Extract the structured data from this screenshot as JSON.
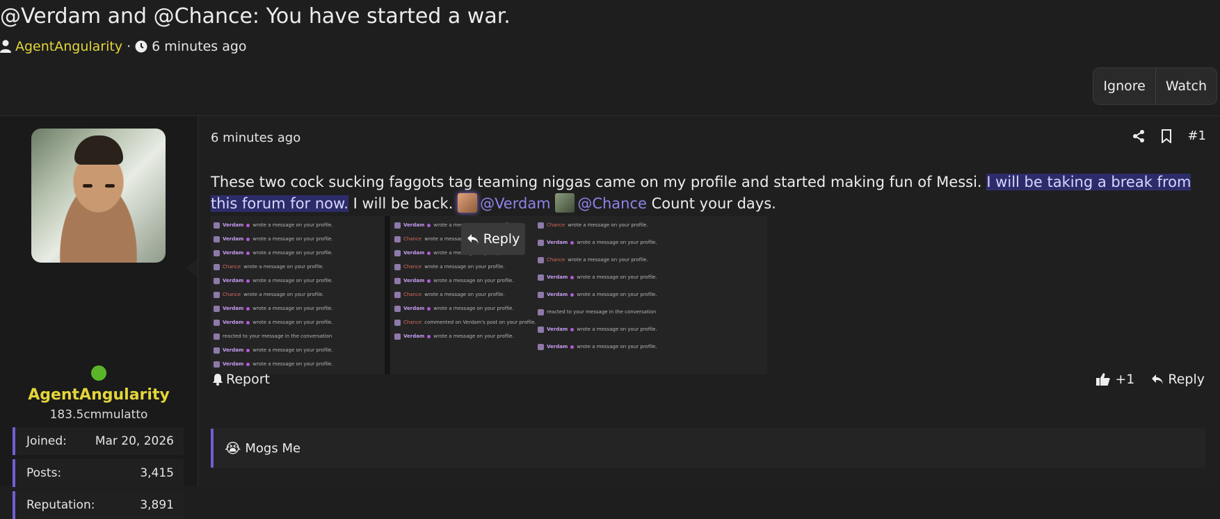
{
  "thread": {
    "title": "@Verdam and @Chance: You have started a war.",
    "author": "AgentAngularity",
    "separator": "·",
    "time": "6 minutes ago"
  },
  "buttons": {
    "ignore": "Ignore",
    "watch": "Watch"
  },
  "user": {
    "name": "AgentAngularity",
    "title": "183.5cmmulatto",
    "stats": [
      {
        "label": "Joined:",
        "value": "Mar 20, 2026"
      },
      {
        "label": "Posts:",
        "value": "3,415"
      },
      {
        "label": "Reputation:",
        "value": "3,891"
      }
    ]
  },
  "post": {
    "time": "6 minutes ago",
    "number": "#1",
    "text_part1": "These two cock sucking faggots tag teaming niggas came on my profile and started making fun of Messi.",
    "text_highlight": "I will be taking a break from this forum for now.",
    "text_part2": "I will be back.",
    "mention_1": "@Verdam",
    "mention_2": "@Chance",
    "text_part3": "Count your days.",
    "reply_popup": "Reply",
    "report": "Report",
    "like": "+1",
    "reply": "Reply",
    "reaction_text": "Mogs Me",
    "reaction_emoji": "😭"
  },
  "screenshot_rows": {
    "col1": [
      "Verdam wrote a message on your profile.",
      "Verdam wrote a message on your profile.",
      "Verdam wrote a message on your profile.",
      "Chance wrote a message on your profile.",
      "Verdam wrote a message on your profile.",
      "Chance wrote a message on your profile.",
      "Verdam wrote a message on your profile.",
      "Verdam wrote a message on your profile.",
      "reacted to your message in the conversation",
      "Verdam wrote a message on your profile.",
      "Verdam wrote a message on your profile."
    ],
    "col2": [
      "Verdam wrote a message on your profile.",
      "Chance wrote a message on your profile.",
      "Verdam wrote a message on your profile.",
      "Chance wrote a message on your profile.",
      "Verdam wrote a message on your profile.",
      "Chance wrote a message on your profile.",
      "Verdam wrote a message on your profile.",
      "Chance commented on Verdam's post on your profile.",
      "Verdam wrote a message on your profile."
    ],
    "col3": [
      "Chance wrote a message on your profile.",
      "Verdam wrote a message on your profile.",
      "Chance wrote a message on your profile.",
      "Verdam wrote a message on your profile.",
      "Verdam wrote a message on your profile.",
      "reacted to your message in the conversation",
      "Verdam wrote a message on your profile.",
      "Verdam wrote a message on your profile."
    ]
  }
}
